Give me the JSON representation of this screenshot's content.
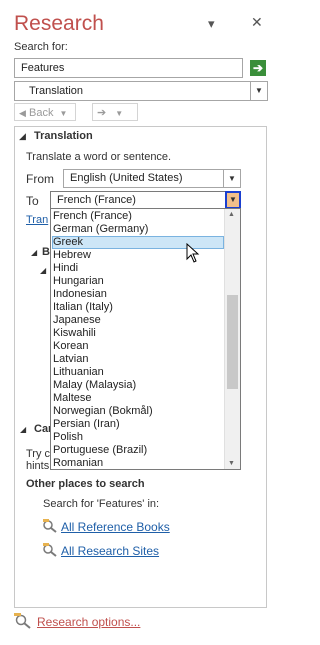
{
  "pane": {
    "title": "Research",
    "minimize_glyph": "▾",
    "close_glyph": "✕"
  },
  "search": {
    "label": "Search for:",
    "value": "Features",
    "go_glyph": "➔"
  },
  "service": {
    "value": "Translation"
  },
  "nav": {
    "back_label": "Back",
    "back_glyph": "◀",
    "forward_glyph": "➔"
  },
  "translation": {
    "heading": "Translation",
    "description": "Translate a word or sentence.",
    "from_label": "From",
    "from_value": "English (United States)",
    "to_label": "To",
    "to_value": "French (France)",
    "partial_link": "Tran"
  },
  "dropdown": {
    "items": [
      "French (France)",
      "German (Germany)",
      "Greek",
      "Hebrew",
      "Hindi",
      "Hungarian",
      "Indonesian",
      "Italian (Italy)",
      "Japanese",
      "Kiswahili",
      "Korean",
      "Latvian",
      "Lithuanian",
      "Malay (Malaysia)",
      "Maltese",
      "Norwegian (Bokmål)",
      "Persian (Iran)",
      "Polish",
      "Portuguese (Brazil)",
      "Romanian"
    ],
    "selected": "Greek"
  },
  "hidden_tree": {
    "b_label": "B",
    "can_label": "Can",
    "try_text": "Try c",
    "hints_text": "hints"
  },
  "other": {
    "heading": "Other places to search",
    "search_for": "Search for 'Features' in:",
    "links": [
      "All Reference Books",
      "All Research Sites"
    ]
  },
  "footer": {
    "options_link": "Research options..."
  },
  "colors": {
    "accent": "#c0504d",
    "link": "#1f5fa8",
    "go_button": "#3a8f3a"
  }
}
